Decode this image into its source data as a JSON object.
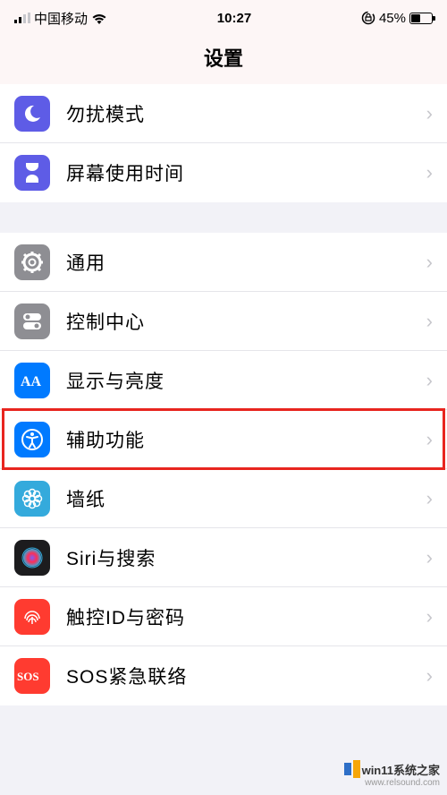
{
  "status": {
    "carrier": "中国移动",
    "time": "10:27",
    "battery_pct": "45%",
    "battery_fill_pct": 45
  },
  "header": {
    "title": "设置"
  },
  "group1": [
    {
      "icon": "moon",
      "bg": "#5e5ce6",
      "label": "勿扰模式"
    },
    {
      "icon": "hourglass",
      "bg": "#5e5ce6",
      "label": "屏幕使用时间"
    }
  ],
  "group2": [
    {
      "icon": "gear",
      "bg": "#8e8e93",
      "label": "通用"
    },
    {
      "icon": "switches",
      "bg": "#8e8e93",
      "label": "控制中心"
    },
    {
      "icon": "aa",
      "bg": "#007aff",
      "label": "显示与亮度"
    },
    {
      "icon": "accessibility",
      "bg": "#007aff",
      "label": "辅助功能",
      "highlighted": true
    },
    {
      "icon": "flower",
      "bg": "#34aadc",
      "label": "墙纸"
    },
    {
      "icon": "siri",
      "bg": "#1c1c1e",
      "label": "Siri与搜索"
    },
    {
      "icon": "touchid",
      "bg": "#ff3b30",
      "label": "触控ID与密码"
    },
    {
      "icon": "sos",
      "bg": "#ff3b30",
      "label": "SOS紧急联络"
    }
  ],
  "watermark": {
    "line1": "win11系统之家",
    "line2": "www.relsound.com"
  }
}
